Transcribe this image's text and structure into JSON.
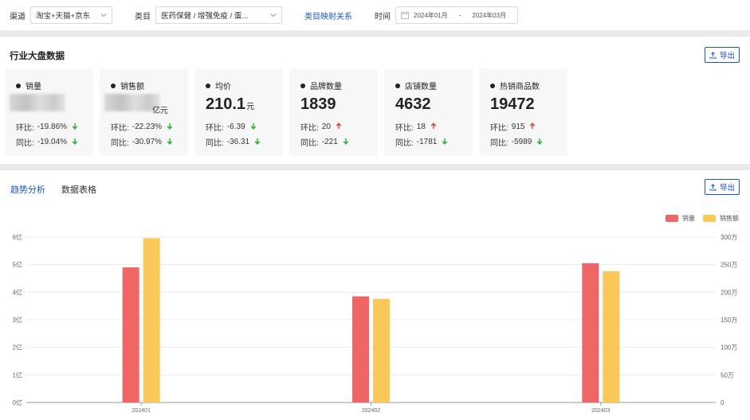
{
  "filters": {
    "channel_label": "渠道",
    "channel_value": "淘宝+天猫+京东",
    "category_label": "类目",
    "category_value": "医药保健 / 增强免疫 / 蛋...",
    "mapping_link": "类目映射关系",
    "time_label": "时间",
    "date_start": "2024年01月",
    "date_sep": "-",
    "date_end": "2024年03月"
  },
  "industry": {
    "title": "行业大盘数据",
    "export_label": "导出",
    "cards": [
      {
        "title": "销量",
        "value": "",
        "unit": "",
        "blurred": true,
        "mom_label": "环比:",
        "mom": "-19.86%",
        "mom_dir": "down",
        "yoy_label": "同比:",
        "yoy": "-19.04%",
        "yoy_dir": "down"
      },
      {
        "title": "销售额",
        "value": "",
        "unit": "亿元",
        "blurred": true,
        "mom_label": "环比:",
        "mom": "-22.23%",
        "mom_dir": "down",
        "yoy_label": "同比:",
        "yoy": "-30.97%",
        "yoy_dir": "down"
      },
      {
        "title": "均价",
        "value": "210.1",
        "unit": "元",
        "blurred": false,
        "mom_label": "环比:",
        "mom": "-6.39",
        "mom_dir": "down",
        "yoy_label": "同比:",
        "yoy": "-36.31",
        "yoy_dir": "down"
      },
      {
        "title": "品牌数量",
        "value": "1839",
        "unit": "",
        "blurred": false,
        "mom_label": "环比:",
        "mom": "20",
        "mom_dir": "up",
        "yoy_label": "同比:",
        "yoy": "-221",
        "yoy_dir": "down"
      },
      {
        "title": "店铺数量",
        "value": "4632",
        "unit": "",
        "blurred": false,
        "mom_label": "环比:",
        "mom": "18",
        "mom_dir": "up",
        "yoy_label": "同比:",
        "yoy": "-1781",
        "yoy_dir": "down"
      },
      {
        "title": "热销商品数",
        "value": "19472",
        "unit": "",
        "blurred": false,
        "mom_label": "环比:",
        "mom": "915",
        "mom_dir": "up",
        "yoy_label": "同比:",
        "yoy": "-5989",
        "yoy_dir": "down"
      }
    ]
  },
  "trend": {
    "tabs": [
      {
        "label": "趋势分析",
        "active": true
      },
      {
        "label": "数据表格",
        "active": false
      }
    ],
    "export_label": "导出"
  },
  "colors": {
    "accent": "#1a56c6",
    "series1": "#ee6666",
    "series2": "#fac858",
    "up": "#e03b3b",
    "down": "#1db322"
  },
  "chart_data": {
    "type": "bar",
    "categories": [
      "202401",
      "202402",
      "202403"
    ],
    "series": [
      {
        "name": "销量",
        "axis": "left",
        "values": [
          4.9,
          3.85,
          5.05
        ]
      },
      {
        "name": "销售额",
        "axis": "right",
        "values": [
          298,
          188,
          238
        ]
      }
    ],
    "y_left": {
      "ticks": [
        "0亿",
        "1亿",
        "2亿",
        "3亿",
        "4亿",
        "5亿",
        "6亿"
      ],
      "range": [
        0,
        6
      ]
    },
    "y_right": {
      "ticks": [
        "0",
        "50万",
        "100万",
        "150万",
        "200万",
        "250万",
        "300万"
      ],
      "range": [
        0,
        300
      ]
    },
    "legend_position": "top-right",
    "grid": true
  }
}
